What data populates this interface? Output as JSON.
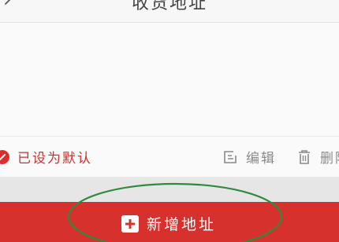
{
  "header": {
    "title": "收货地址",
    "back_icon": "chevron-left-icon"
  },
  "address_card": {
    "default_label": "已设为默认",
    "default_icon": "check-circle-icon",
    "edit_label": "编辑",
    "edit_icon": "edit-icon",
    "delete_label": "删除",
    "delete_icon": "trash-icon"
  },
  "footer": {
    "add_label": "新增地址",
    "add_icon": "plus-icon"
  },
  "colors": {
    "accent": "#d6312c",
    "annotation": "#2e8b3e"
  }
}
